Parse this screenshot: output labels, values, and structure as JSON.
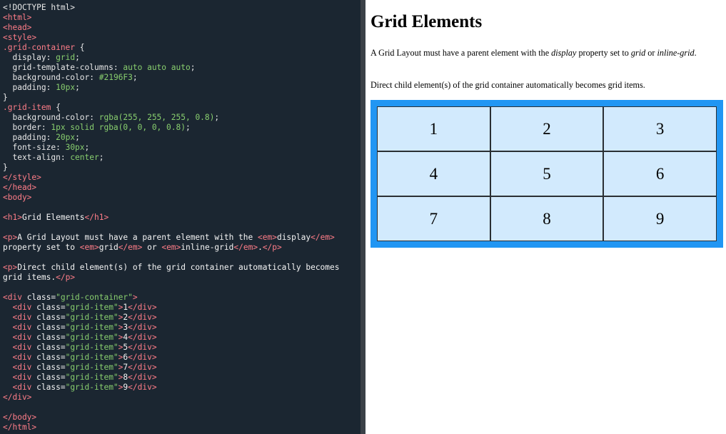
{
  "editor": {
    "code_lines": [
      [
        [
          "t-ent",
          "<!DOCTYPE html>"
        ]
      ],
      [
        [
          "t-tag",
          "<html>"
        ]
      ],
      [
        [
          "t-tag",
          "<head>"
        ]
      ],
      [
        [
          "t-tag",
          "<style>"
        ]
      ],
      [
        [
          "t-sel",
          ".grid-container"
        ],
        [
          "t-punc",
          " {"
        ]
      ],
      [
        [
          "t-prop",
          "  display"
        ],
        [
          "t-punc",
          ": "
        ],
        [
          "t-val",
          "grid"
        ],
        [
          "t-punc",
          ";"
        ]
      ],
      [
        [
          "t-prop",
          "  grid-template-columns"
        ],
        [
          "t-punc",
          ": "
        ],
        [
          "t-val",
          "auto auto auto"
        ],
        [
          "t-punc",
          ";"
        ]
      ],
      [
        [
          "t-prop",
          "  background-color"
        ],
        [
          "t-punc",
          ": "
        ],
        [
          "t-val",
          "#2196F3"
        ],
        [
          "t-punc",
          ";"
        ]
      ],
      [
        [
          "t-prop",
          "  padding"
        ],
        [
          "t-punc",
          ": "
        ],
        [
          "t-val",
          "10px"
        ],
        [
          "t-punc",
          ";"
        ]
      ],
      [
        [
          "t-punc",
          "}"
        ]
      ],
      [
        [
          "t-sel",
          ".grid-item"
        ],
        [
          "t-punc",
          " {"
        ]
      ],
      [
        [
          "t-prop",
          "  background-color"
        ],
        [
          "t-punc",
          ": "
        ],
        [
          "t-val",
          "rgba(255, 255, 255, 0.8)"
        ],
        [
          "t-punc",
          ";"
        ]
      ],
      [
        [
          "t-prop",
          "  border"
        ],
        [
          "t-punc",
          ": "
        ],
        [
          "t-val",
          "1px solid rgba(0, 0, 0, 0.8)"
        ],
        [
          "t-punc",
          ";"
        ]
      ],
      [
        [
          "t-prop",
          "  padding"
        ],
        [
          "t-punc",
          ": "
        ],
        [
          "t-val",
          "20px"
        ],
        [
          "t-punc",
          ";"
        ]
      ],
      [
        [
          "t-prop",
          "  font-size"
        ],
        [
          "t-punc",
          ": "
        ],
        [
          "t-val",
          "30px"
        ],
        [
          "t-punc",
          ";"
        ]
      ],
      [
        [
          "t-prop",
          "  text-align"
        ],
        [
          "t-punc",
          ": "
        ],
        [
          "t-val",
          "center"
        ],
        [
          "t-punc",
          ";"
        ]
      ],
      [
        [
          "t-punc",
          "}"
        ]
      ],
      [
        [
          "t-tag",
          "</style>"
        ]
      ],
      [
        [
          "t-tag",
          "</head>"
        ]
      ],
      [
        [
          "t-tag",
          "<body>"
        ]
      ],
      [],
      [
        [
          "t-tag",
          "<h1>"
        ],
        [
          "t-text",
          "Grid Elements"
        ],
        [
          "t-tag",
          "</h1>"
        ]
      ],
      [],
      [
        [
          "t-tag",
          "<p>"
        ],
        [
          "t-text",
          "A Grid Layout must have a parent element with the "
        ],
        [
          "t-tag",
          "<em>"
        ],
        [
          "t-text",
          "display"
        ],
        [
          "t-tag",
          "</em>"
        ]
      ],
      [
        [
          "t-text",
          "property set to "
        ],
        [
          "t-tag",
          "<em>"
        ],
        [
          "t-text",
          "grid"
        ],
        [
          "t-tag",
          "</em>"
        ],
        [
          "t-text",
          " or "
        ],
        [
          "t-tag",
          "<em>"
        ],
        [
          "t-text",
          "inline-grid"
        ],
        [
          "t-tag",
          "</em>"
        ],
        [
          "t-text",
          "."
        ],
        [
          "t-tag",
          "</p>"
        ]
      ],
      [],
      [
        [
          "t-tag",
          "<p>"
        ],
        [
          "t-text",
          "Direct child element(s) of the grid container automatically becomes"
        ]
      ],
      [
        [
          "t-text",
          "grid items."
        ],
        [
          "t-tag",
          "</p>"
        ]
      ],
      [],
      [
        [
          "t-tag",
          "<div "
        ],
        [
          "t-attr",
          "class="
        ],
        [
          "t-val",
          "\"grid-container\""
        ],
        [
          "t-tag",
          ">"
        ]
      ],
      [
        [
          "t-tag",
          "  <div "
        ],
        [
          "t-attr",
          "class="
        ],
        [
          "t-val",
          "\"grid-item\""
        ],
        [
          "t-tag",
          ">"
        ],
        [
          "t-text",
          "1"
        ],
        [
          "t-tag",
          "</div>"
        ]
      ],
      [
        [
          "t-tag",
          "  <div "
        ],
        [
          "t-attr",
          "class="
        ],
        [
          "t-val",
          "\"grid-item\""
        ],
        [
          "t-tag",
          ">"
        ],
        [
          "t-text",
          "2"
        ],
        [
          "t-tag",
          "</div>"
        ]
      ],
      [
        [
          "t-tag",
          "  <div "
        ],
        [
          "t-attr",
          "class="
        ],
        [
          "t-val",
          "\"grid-item\""
        ],
        [
          "t-tag",
          ">"
        ],
        [
          "t-text",
          "3"
        ],
        [
          "t-tag",
          "</div>"
        ]
      ],
      [
        [
          "t-tag",
          "  <div "
        ],
        [
          "t-attr",
          "class="
        ],
        [
          "t-val",
          "\"grid-item\""
        ],
        [
          "t-tag",
          ">"
        ],
        [
          "t-text",
          "4"
        ],
        [
          "t-tag",
          "</div>"
        ]
      ],
      [
        [
          "t-tag",
          "  <div "
        ],
        [
          "t-attr",
          "class="
        ],
        [
          "t-val",
          "\"grid-item\""
        ],
        [
          "t-tag",
          ">"
        ],
        [
          "t-text",
          "5"
        ],
        [
          "t-tag",
          "</div>"
        ]
      ],
      [
        [
          "t-tag",
          "  <div "
        ],
        [
          "t-attr",
          "class="
        ],
        [
          "t-val",
          "\"grid-item\""
        ],
        [
          "t-tag",
          ">"
        ],
        [
          "t-text",
          "6"
        ],
        [
          "t-tag",
          "</div>"
        ]
      ],
      [
        [
          "t-tag",
          "  <div "
        ],
        [
          "t-attr",
          "class="
        ],
        [
          "t-val",
          "\"grid-item\""
        ],
        [
          "t-tag",
          ">"
        ],
        [
          "t-text",
          "7"
        ],
        [
          "t-tag",
          "</div>"
        ]
      ],
      [
        [
          "t-tag",
          "  <div "
        ],
        [
          "t-attr",
          "class="
        ],
        [
          "t-val",
          "\"grid-item\""
        ],
        [
          "t-tag",
          ">"
        ],
        [
          "t-text",
          "8"
        ],
        [
          "t-tag",
          "</div>"
        ]
      ],
      [
        [
          "t-tag",
          "  <div "
        ],
        [
          "t-attr",
          "class="
        ],
        [
          "t-val",
          "\"grid-item\""
        ],
        [
          "t-tag",
          ">"
        ],
        [
          "t-text",
          "9"
        ],
        [
          "t-tag",
          "</div>"
        ]
      ],
      [
        [
          "t-tag",
          "</div>"
        ]
      ],
      [],
      [
        [
          "t-tag",
          "</body>"
        ]
      ],
      [
        [
          "t-tag",
          "</html>"
        ]
      ]
    ]
  },
  "result": {
    "heading": "Grid Elements",
    "paragraph1": {
      "before": "A Grid Layout must have a parent element with the ",
      "em1": "display",
      "middle": " property set to ",
      "em2": "grid",
      "or": " or ",
      "em3": "inline-grid",
      "end": "."
    },
    "paragraph2": "Direct child element(s) of the grid container automatically becomes grid items.",
    "grid_items": [
      "1",
      "2",
      "3",
      "4",
      "5",
      "6",
      "7",
      "8",
      "9"
    ]
  },
  "colors": {
    "editor_bg": "#1b2631",
    "grid_container_bg": "#2196F3",
    "tag": "#ff7d88",
    "value": "#88ce6e"
  }
}
